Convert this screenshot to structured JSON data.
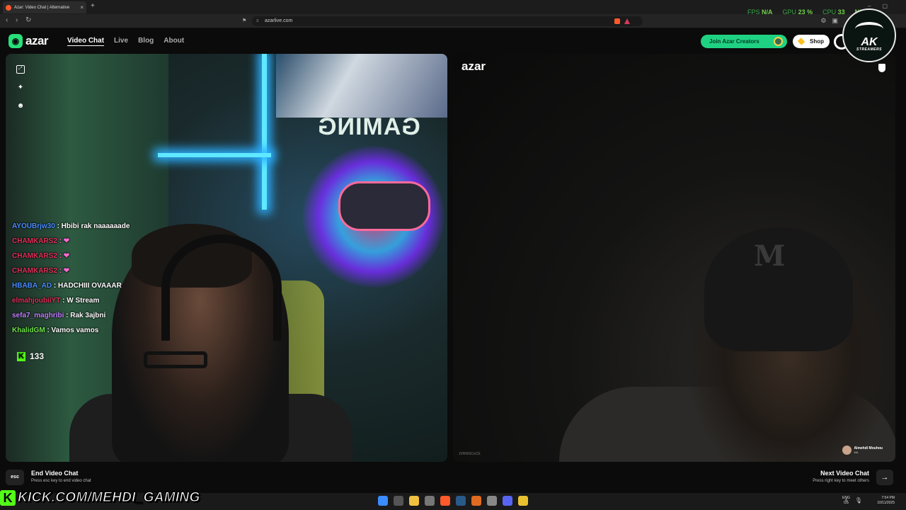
{
  "browser": {
    "tab_title": "Azar: Video Chat | Alternative",
    "url": "azarlive.com"
  },
  "overlay_stats": {
    "fps_label": "FPS",
    "fps_value": "N/A",
    "gpu_label": "GPU",
    "gpu_value": "23 %",
    "cpu_label": "CPU",
    "cpu_value": "33",
    "extra_value": "N/A"
  },
  "header": {
    "logo_text": "azar",
    "nav": [
      "Video Chat",
      "Live",
      "Blog",
      "About"
    ],
    "creators_button": "Join Azar Creators",
    "shop_button": "Shop"
  },
  "badge": {
    "text": "AK",
    "subtext": "STREAMERS"
  },
  "chat": {
    "messages": [
      {
        "user": "AYOUBrjw30",
        "text": ": Hbibi rak naaaaaade",
        "color": "#4a8cff"
      },
      {
        "user": "CHAMKARS2",
        "text": ": ❤",
        "color": "#e0305a"
      },
      {
        "user": "CHAMKARS2",
        "text": ": ❤",
        "color": "#e0305a"
      },
      {
        "user": "CHAMKARS2",
        "text": ": ❤",
        "color": "#e0305a"
      },
      {
        "user": "HBABA_AD",
        "text": ": HADCHIII OVAAAR",
        "color": "#4a8cff"
      },
      {
        "user": "elmahjoubiiYT",
        "text": ": W Stream",
        "color": "#e0305a"
      },
      {
        "user": "sefa7_maghribi",
        "text": ": Rak 3ajbni",
        "color": "#c080ff"
      },
      {
        "user": "KhalidGM",
        "text": ": Vamos vamos",
        "color": "#6fe34a"
      }
    ],
    "viewer_count": "133"
  },
  "remote": {
    "watermark": "azar",
    "id_text": "JVRWSCeCE",
    "name": "Almehdi Mouhou",
    "country": "MA"
  },
  "bottom": {
    "esc_key": "esc",
    "end_label": "End Video Chat",
    "end_hint": "Press esc key to end video chat",
    "next_label": "Next Video Chat",
    "next_hint": "Press right key to meet others"
  },
  "banner": {
    "k": "K",
    "text": "KICK.COM/MEHDI_GAMING"
  },
  "taskbar": {
    "lang": "ENG",
    "region": "US",
    "time": "7:54 PM",
    "date": "10/11/2025"
  },
  "colors": {
    "kick_green": "#53fc18",
    "azar_green": "#1fd283"
  }
}
